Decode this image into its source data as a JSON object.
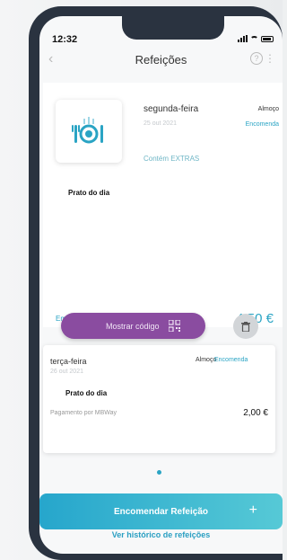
{
  "status_bar": {
    "time": "12:32"
  },
  "header": {
    "title": "Refeições"
  },
  "meals": [
    {
      "day": "segunda-feira",
      "date": "25 out 2021",
      "meal_type": "Almoço",
      "status": "Encomenda",
      "extras": "Contém EXTRAS",
      "dish": "Prato do dia",
      "progress": "Em curso",
      "price": "4,50 €"
    },
    {
      "day": "terça-feira",
      "date": "26 out 2021",
      "meal_type": "Almoço",
      "status": "Encomenda",
      "dish": "Prato do dia",
      "payment": "Pagamento por MBWay",
      "price": "2,00 €"
    }
  ],
  "actions": {
    "show_code": "Mostrar código",
    "order_meal": "Encomendar Refeição",
    "history": "Ver histórico de refeições"
  },
  "pagination": {
    "active_page": 1,
    "total_pages": 1
  },
  "colors": {
    "accent": "#2aa4c4",
    "purple": "#8a4ca0",
    "phone_frame": "#2a3340"
  },
  "icons": [
    "back-chevron-icon",
    "help-icon",
    "more-icon",
    "plate-cutlery-icon",
    "qr-code-icon",
    "trash-icon",
    "plus-icon",
    "signal-icon",
    "wifi-icon",
    "battery-icon"
  ]
}
